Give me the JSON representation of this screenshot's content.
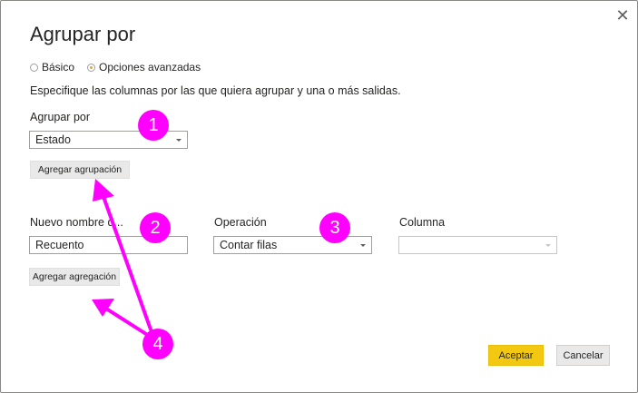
{
  "dialog": {
    "title": "Agrupar por",
    "close_glyph": "✕"
  },
  "mode": {
    "basic_label": "Básico",
    "advanced_label": "Opciones avanzadas",
    "selected": "advanced"
  },
  "instructions": "Especifique las columnas por las que quiera agrupar y una o más salidas.",
  "group_by": {
    "label": "Agrupar por",
    "selected_value": "Estado",
    "add_grouping_label": "Agregar agrupación"
  },
  "aggregation": {
    "new_column_label": "Nuevo nombre d...",
    "new_column_value": "Recuento",
    "operation_label": "Operación",
    "operation_value": "Contar filas",
    "column_label": "Columna",
    "column_value": "",
    "add_aggregation_label": "Agregar agregación"
  },
  "footer": {
    "accept_label": "Aceptar",
    "cancel_label": "Cancelar"
  },
  "annotations": {
    "color": "#ff00ff",
    "badges": [
      "1",
      "2",
      "3",
      "4"
    ]
  },
  "colors": {
    "accent": "#f2c811",
    "radio_selected": "#e1a913",
    "border": "#a19f9d"
  }
}
